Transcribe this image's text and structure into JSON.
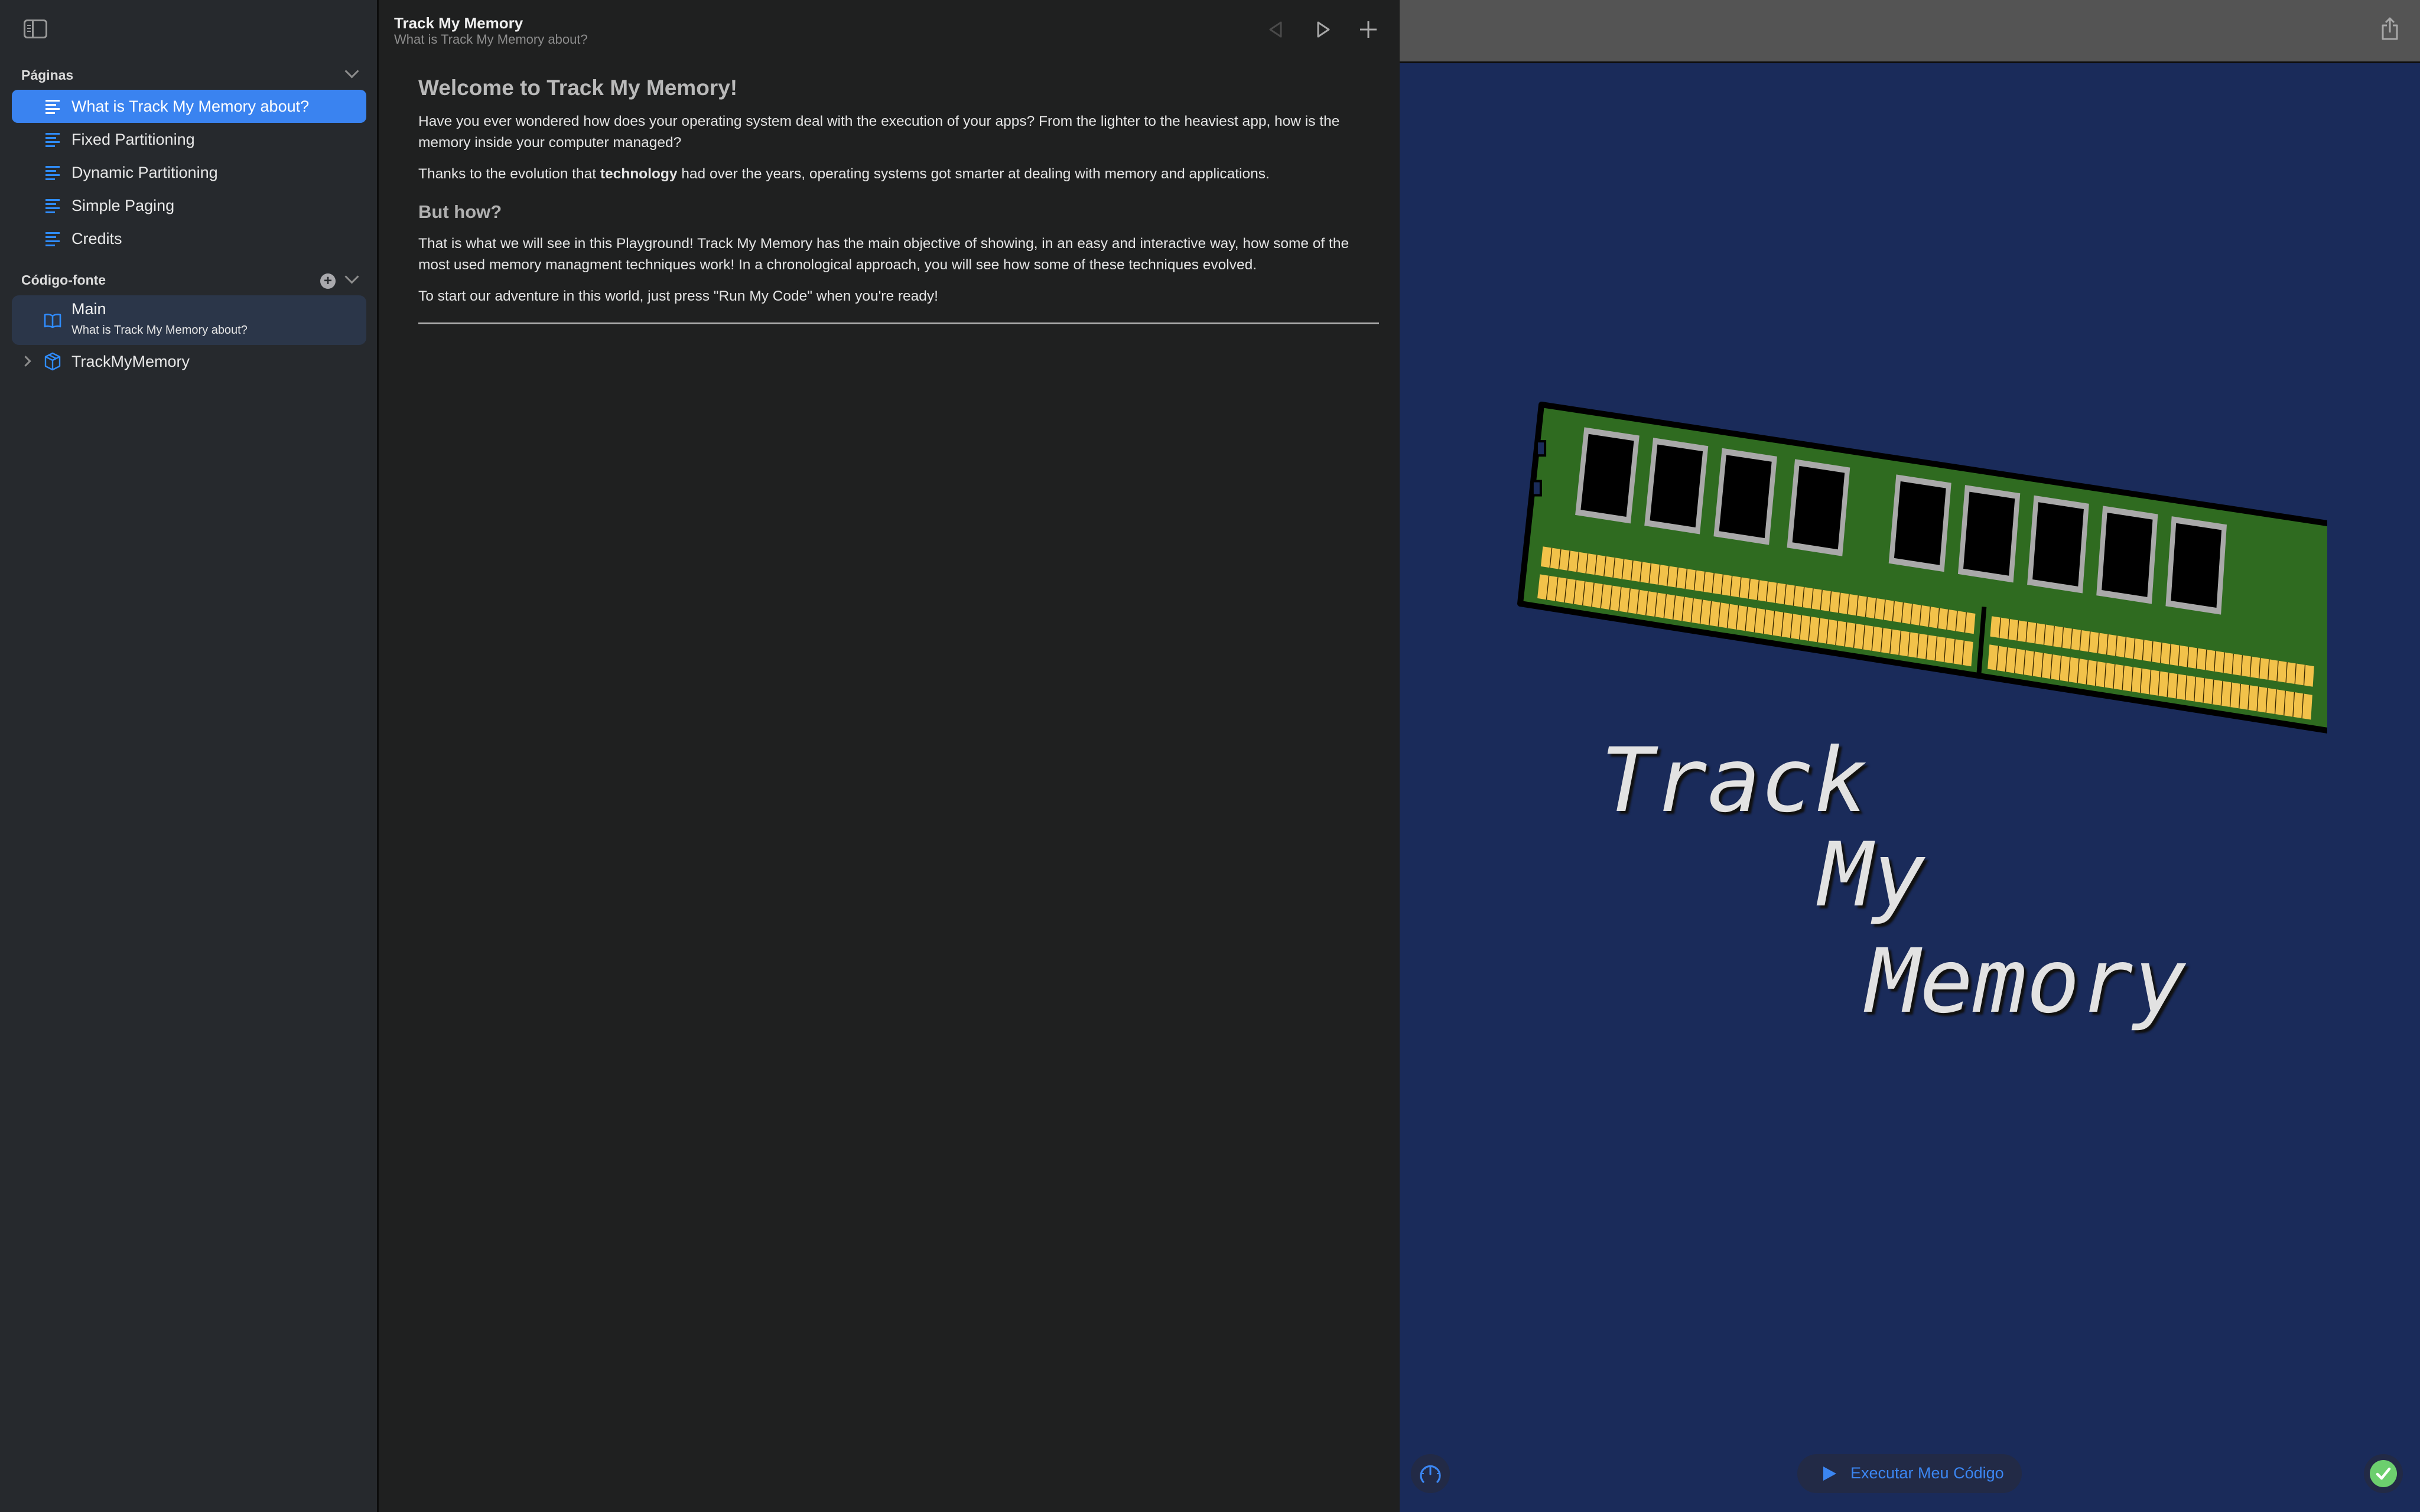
{
  "sidebar": {
    "toggle_icon": "sidebar-toggle-icon",
    "pages_section": {
      "title": "Páginas",
      "items": [
        {
          "label": "What is Track My Memory about?",
          "selected": true,
          "icon": "page-text-icon"
        },
        {
          "label": "Fixed Partitioning",
          "selected": false,
          "icon": "page-text-icon"
        },
        {
          "label": "Dynamic Partitioning",
          "selected": false,
          "icon": "page-text-icon"
        },
        {
          "label": "Simple Paging",
          "selected": false,
          "icon": "page-text-icon"
        },
        {
          "label": "Credits",
          "selected": false,
          "icon": "page-text-icon"
        }
      ]
    },
    "source_section": {
      "title": "Código-fonte",
      "items": [
        {
          "label": "Main",
          "subtitle": "What is Track My Memory about?",
          "icon": "book-icon"
        },
        {
          "label": "TrackMyMemory",
          "icon": "package-icon",
          "expandable": true
        }
      ]
    }
  },
  "editor": {
    "title": "Track My Memory",
    "subtitle": "What is Track My Memory about?",
    "toolbar": {
      "previous_icon": "previous-page-icon",
      "run_icon": "run-icon",
      "add_icon": "plus-icon"
    },
    "document": {
      "heading1": "Welcome to Track My Memory!",
      "para1": "Have you ever wondered how does your operating system deal with the execution of your apps? From the lighter to the heaviest app, how is the memory inside your computer managed?",
      "para2_before": "Thanks to the evolution that ",
      "para2_bold": "technology",
      "para2_after": " had over the years, operating systems got smarter at dealing with memory and applications.",
      "heading2": "But how?",
      "para3": "That is what we will see in this Playground! Track My Memory has the main objective of showing, in an easy and interactive way, how some of the most used memory managment techniques work! In a chronological approach, you will see how some of these techniques evolved.",
      "para4": "To start our adventure in this world, just press \"Run My Code\" when you're ready!"
    }
  },
  "live_view": {
    "share_icon": "share-icon",
    "illustration": "ram-module",
    "title_lines": [
      "Track",
      "My",
      "Memory"
    ],
    "bottom_bar": {
      "speed_icon": "speedometer-icon",
      "run_button_label": "Executar Meu Código",
      "status_icon": "checkmark-icon"
    }
  },
  "colors": {
    "accent": "#3a83f0",
    "live_background": "#1a2b5a",
    "status_green": "#6ccf6e",
    "pcb_green": "#2f6b20",
    "gold_contacts": "#f2c24a"
  }
}
